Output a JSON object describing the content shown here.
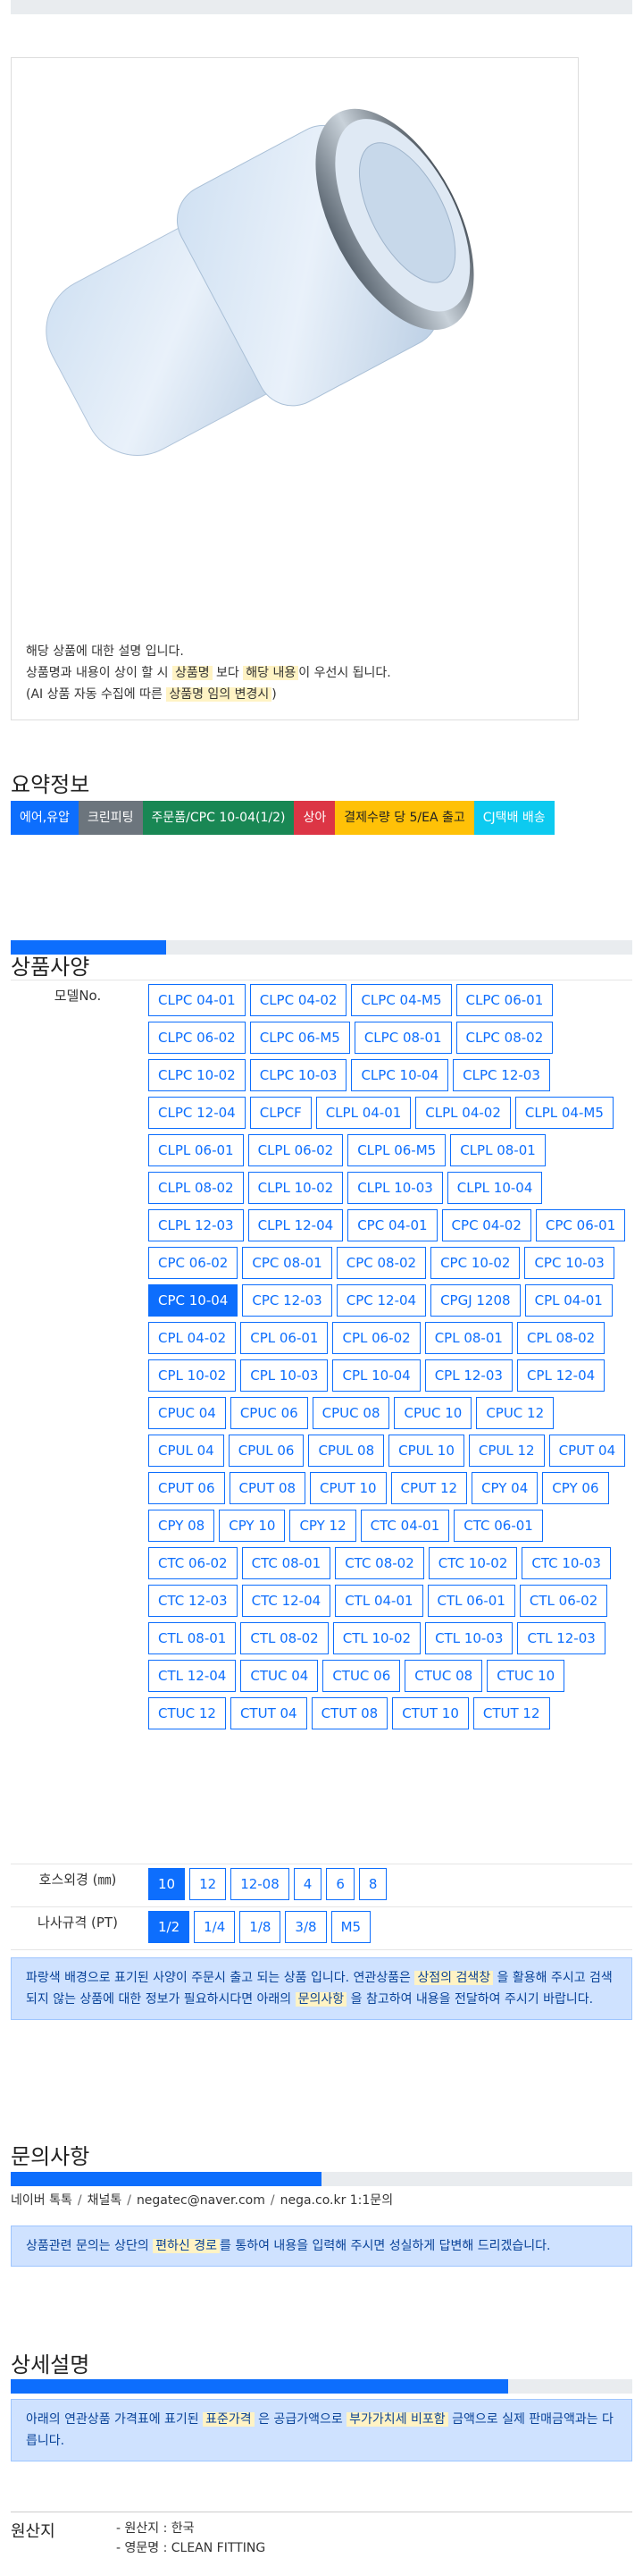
{
  "note": {
    "line1": "해당 상품에 대한 설명 입니다.",
    "line2_a": "상품명과 내용이 상이 할 시 ",
    "line2_hl1": "상품명",
    "line2_b": " 보다 ",
    "line2_hl2": "해당 내용",
    "line2_c": "이 우선시 됩니다.",
    "line3_a": "(AI 상품 자동 수집에 따른 ",
    "line3_hl": "상품명 임의 변경시",
    "line3_b": ")"
  },
  "summary": {
    "title": "요약정보",
    "badges": [
      {
        "label": "에어,유압",
        "color": "blue"
      },
      {
        "label": "크린피팅",
        "color": "gray"
      },
      {
        "label": "주문품/CPC 10-04(1/2)",
        "color": "green"
      },
      {
        "label": "상아",
        "color": "red"
      },
      {
        "label": "결제수량 당 5/EA 출고",
        "color": "yellow"
      },
      {
        "label": "CJ택배 배송",
        "color": "cyan"
      }
    ]
  },
  "spec": {
    "title": "상품사양",
    "progress_fraction": 0.25,
    "model_label": "모델No.",
    "models": [
      "CLPC 04-01",
      "CLPC 04-02",
      "CLPC 04-M5",
      "CLPC 06-01",
      "CLPC 06-02",
      "CLPC 06-M5",
      "CLPC 08-01",
      "CLPC 08-02",
      "CLPC 10-02",
      "CLPC 10-03",
      "CLPC 10-04",
      "CLPC 12-03",
      "CLPC 12-04",
      "CLPCF",
      "CLPL 04-01",
      "CLPL 04-02",
      "CLPL 04-M5",
      "CLPL 06-01",
      "CLPL 06-02",
      "CLPL 06-M5",
      "CLPL 08-01",
      "CLPL 08-02",
      "CLPL 10-02",
      "CLPL 10-03",
      "CLPL 10-04",
      "CLPL 12-03",
      "CLPL 12-04",
      "CPC 04-01",
      "CPC 04-02",
      "CPC 06-01",
      "CPC 06-02",
      "CPC 08-01",
      "CPC 08-02",
      "CPC 10-02",
      "CPC 10-03",
      "CPC 10-04",
      "CPC 12-03",
      "CPC 12-04",
      "CPGJ 1208",
      "CPL 04-01",
      "CPL 04-02",
      "CPL 06-01",
      "CPL 06-02",
      "CPL 08-01",
      "CPL 08-02",
      "CPL 10-02",
      "CPL 10-03",
      "CPL 10-04",
      "CPL 12-03",
      "CPL 12-04",
      "CPUC 04",
      "CPUC 06",
      "CPUC 08",
      "CPUC 10",
      "CPUC 12",
      "CPUL 04",
      "CPUL 06",
      "CPUL 08",
      "CPUL 10",
      "CPUL 12",
      "CPUT 04",
      "CPUT 06",
      "CPUT 08",
      "CPUT 10",
      "CPUT 12",
      "CPY 04",
      "CPY 06",
      "CPY 08",
      "CPY 10",
      "CPY 12",
      "CTC 04-01",
      "CTC 06-01",
      "CTC 06-02",
      "CTC 08-01",
      "CTC 08-02",
      "CTC 10-02",
      "CTC 10-03",
      "CTC 12-03",
      "CTC 12-04",
      "CTL 04-01",
      "CTL 06-01",
      "CTL 06-02",
      "CTL 08-01",
      "CTL 08-02",
      "CTL 10-02",
      "CTL 10-03",
      "CTL 12-03",
      "CTL 12-04",
      "CTUC 04",
      "CTUC 06",
      "CTUC 08",
      "CTUC 10",
      "CTUC 12",
      "CTUT 04",
      "CTUT 08",
      "CTUT 10",
      "CTUT 12"
    ],
    "selected_model": "CPC 10-04",
    "hose_label": "호스외경 (㎜)",
    "hose": [
      "10",
      "12",
      "12-08",
      "4",
      "6",
      "8"
    ],
    "selected_hose": "10",
    "thread_label": "나사규격 (PT)",
    "thread": [
      "1/2",
      "1/4",
      "1/8",
      "3/8",
      "M5"
    ],
    "selected_thread": "1/2",
    "notice_a": "파랑색 배경으로 표기된 사양이 주문시 출고 되는 상품 입니다. 연관상품은 ",
    "notice_hl1": "상점의 검색창",
    "notice_b": " 을 활용해 주시고 검색되지 않는 상품에 대한 정보가 필요하시다면 아래의 ",
    "notice_hl2": "문의사항",
    "notice_c": " 을 참고하여 내용을 전달하여 주시기 바랍니다."
  },
  "inquiry": {
    "title": "문의사항",
    "progress_fraction": 0.5,
    "contacts": [
      "네이버 톡톡",
      "채널톡",
      "negatec@naver.com",
      "nega.co.kr 1:1문의"
    ],
    "notice_a": "상품관련 문의는 상단의 ",
    "notice_hl": "편하신 경로",
    "notice_b": "를 통하여 내용을 입력해 주시면 성실하게 답변해 드리겠습니다."
  },
  "detail": {
    "title": "상세설명",
    "progress_fraction": 0.8,
    "notice_a": "아래의 연관상품 가격표에 표기된 ",
    "notice_hl1": "표준가격",
    "notice_b": " 은 공급가액으로 ",
    "notice_hl2": "부가가치세 비포함",
    "notice_c": " 금액으로 실제 판매금액과는 다릅니다."
  },
  "origin": {
    "label": "원산지",
    "line1": "- 원산지 : 한국",
    "line2": "- 영문명 : CLEAN FITTING"
  }
}
